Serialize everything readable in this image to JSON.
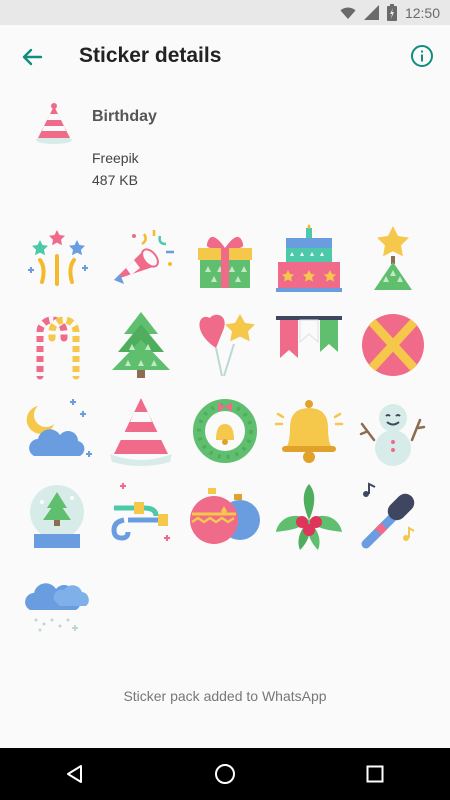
{
  "status": {
    "time": "12:50",
    "icons": [
      "wifi-icon",
      "signal-icon",
      "battery-icon"
    ]
  },
  "toolbar": {
    "title": "Sticker details",
    "back_icon": "arrow-left-icon",
    "info_icon": "info-icon",
    "accent": "#128c7e"
  },
  "pack": {
    "name": "Birthday",
    "publisher": "Freepik",
    "size": "487 KB",
    "tray_icon": "party-hat-icon"
  },
  "stickers": [
    {
      "name": "fireworks"
    },
    {
      "name": "party-horn"
    },
    {
      "name": "gift-box"
    },
    {
      "name": "birthday-cake"
    },
    {
      "name": "star-tree"
    },
    {
      "name": "candy-canes"
    },
    {
      "name": "christmas-tree"
    },
    {
      "name": "balloons"
    },
    {
      "name": "bunting"
    },
    {
      "name": "ribbon-ball"
    },
    {
      "name": "night-cloud"
    },
    {
      "name": "party-hat"
    },
    {
      "name": "wreath-bell"
    },
    {
      "name": "golden-bell"
    },
    {
      "name": "snowman"
    },
    {
      "name": "snow-globe"
    },
    {
      "name": "party-blowers"
    },
    {
      "name": "ornaments"
    },
    {
      "name": "holly"
    },
    {
      "name": "microphone"
    },
    {
      "name": "snow-cloud"
    }
  ],
  "footer": {
    "message": "Sticker pack added to WhatsApp"
  },
  "nav": {
    "back_icon": "triangle-back-icon",
    "home_icon": "circle-home-icon",
    "recents_icon": "square-recents-icon"
  }
}
